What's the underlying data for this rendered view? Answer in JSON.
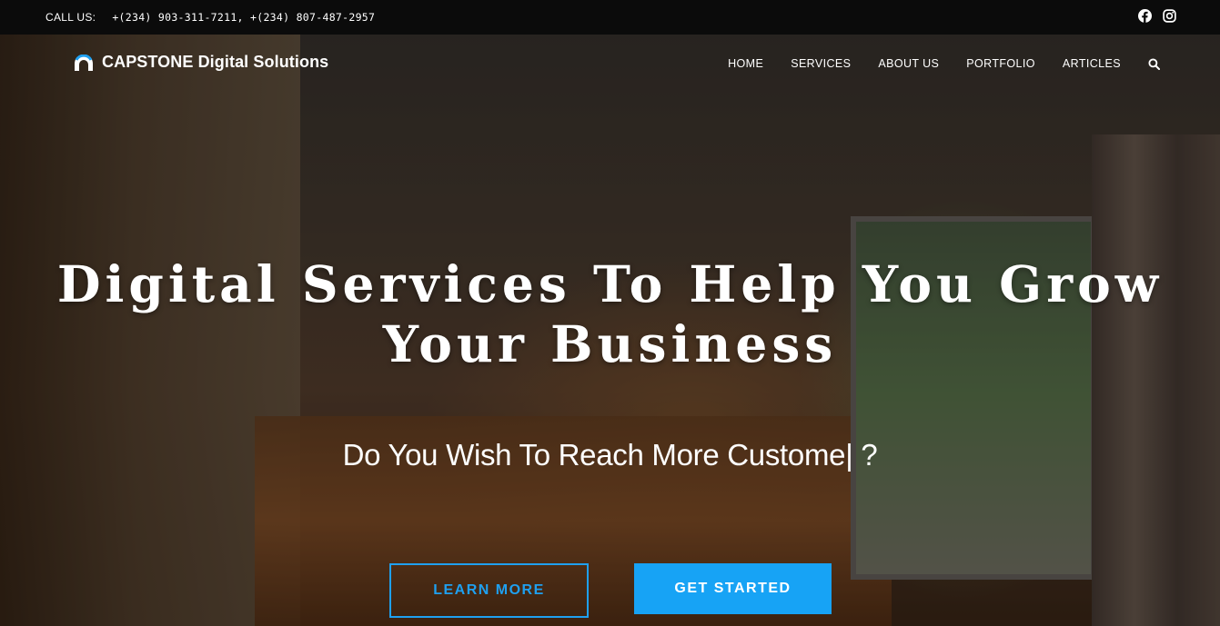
{
  "topbar": {
    "call_label": "CALL US:",
    "phones": "+(234) 903-311-7211, +(234) 807-487-2957",
    "social": [
      {
        "icon": "facebook-icon"
      },
      {
        "icon": "instagram-icon"
      }
    ]
  },
  "brand": {
    "logo_icon": "arch-logo-icon",
    "name": "CAPSTONE Digital Solutions",
    "accent": "#1fa0f0"
  },
  "nav": {
    "items": [
      {
        "label": "HOME"
      },
      {
        "label": "SERVICES"
      },
      {
        "label": "ABOUT US"
      },
      {
        "label": "PORTFOLIO"
      },
      {
        "label": "ARTICLES"
      }
    ],
    "search_icon": "search-icon"
  },
  "hero": {
    "headline_line1": "Digital Services To Help You Grow",
    "headline_line2": "Your Business",
    "subheadline": "Do You Wish To Reach More Custome| ?",
    "learn_more": "LEARN MORE",
    "get_started": "GET STARTED"
  },
  "colors": {
    "topbar_bg": "#0b0b0b",
    "button_primary": "#17a3f5",
    "button_outline": "#1fa0f0"
  }
}
